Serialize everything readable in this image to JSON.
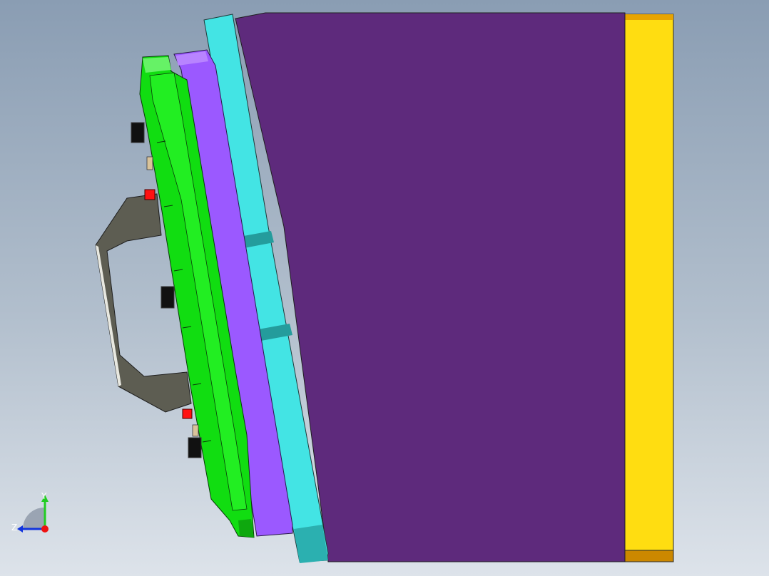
{
  "viewport": {
    "background_top": "#8a9db3",
    "background_bottom": "#dde3ea"
  },
  "model": {
    "parts": {
      "main_block": {
        "color": "#5e2a7c"
      },
      "yellow_plate": {
        "color": "#ffdd11",
        "edge_color": "#cc8800"
      },
      "cyan_plate": {
        "color": "#43e4e4"
      },
      "violet_plate": {
        "color": "#9b59ff"
      },
      "green_plate": {
        "color": "#11dd11"
      },
      "handle": {
        "color": "#5d5d52"
      },
      "red_clamp": {
        "color": "#ff1111"
      },
      "black_knob": {
        "color": "#111111"
      }
    }
  },
  "triad": {
    "y_label": "Y",
    "z_label": "Z",
    "y_color": "#22cc22",
    "z_color": "#1133dd",
    "origin_color": "#ee1111"
  }
}
